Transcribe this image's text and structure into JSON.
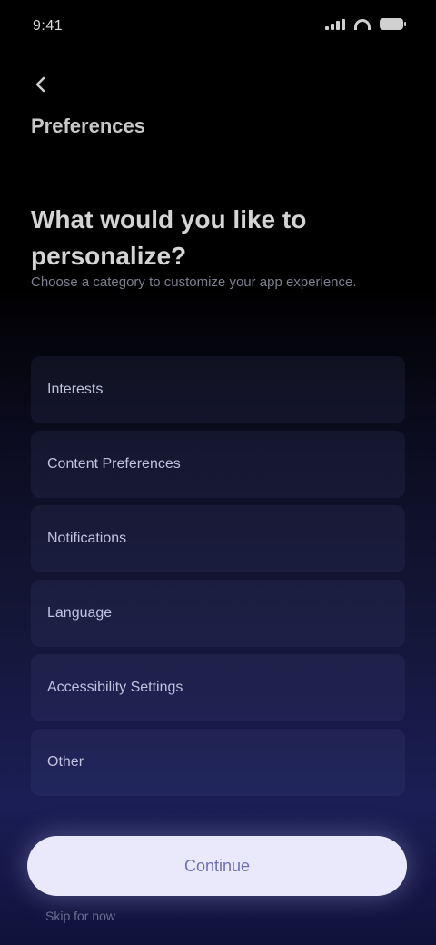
{
  "status_bar": {
    "time": "9:41"
  },
  "header": {
    "title": "Preferences"
  },
  "intro": {
    "headline": "What would you like to personalize?",
    "subtext": "Choose a category to customize your app experience."
  },
  "options": [
    {
      "label": "Interests"
    },
    {
      "label": "Content Preferences"
    },
    {
      "label": "Notifications"
    },
    {
      "label": "Language"
    },
    {
      "label": "Accessibility Settings"
    },
    {
      "label": "Other"
    }
  ],
  "footer": {
    "primary_button": "Continue",
    "secondary_text": "Skip for now"
  }
}
